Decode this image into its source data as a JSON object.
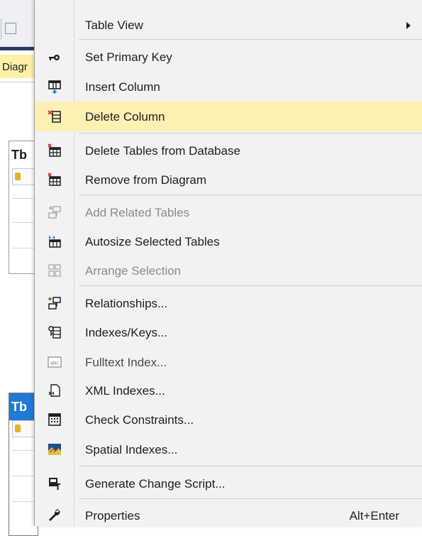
{
  "background": {
    "diagram_tab_label": "Diagr",
    "table1_title": "Tb",
    "table2_title": "Tb"
  },
  "menu": {
    "items": [
      {
        "label": "Table View",
        "icon": "table-view-icon",
        "disabled": false,
        "highlight": false,
        "submenu": true,
        "shortcut": ""
      },
      {
        "label": "Set Primary Key",
        "icon": "key-icon",
        "disabled": false,
        "highlight": false,
        "submenu": false,
        "shortcut": ""
      },
      {
        "label": "Insert Column",
        "icon": "insert-column-icon",
        "disabled": false,
        "highlight": false,
        "submenu": false,
        "shortcut": ""
      },
      {
        "label": "Delete Column",
        "icon": "delete-column-icon",
        "disabled": false,
        "highlight": true,
        "submenu": false,
        "shortcut": ""
      },
      {
        "label": "Delete Tables from Database",
        "icon": "delete-table-icon",
        "disabled": false,
        "highlight": false,
        "submenu": false,
        "shortcut": ""
      },
      {
        "label": "Remove from Diagram",
        "icon": "remove-table-icon",
        "disabled": false,
        "highlight": false,
        "submenu": false,
        "shortcut": ""
      },
      {
        "label": "Add Related Tables",
        "icon": "add-related-tables-icon",
        "disabled": true,
        "highlight": false,
        "submenu": false,
        "shortcut": ""
      },
      {
        "label": "Autosize Selected Tables",
        "icon": "autosize-icon",
        "disabled": false,
        "highlight": false,
        "submenu": false,
        "shortcut": ""
      },
      {
        "label": "Arrange Selection",
        "icon": "arrange-icon",
        "disabled": true,
        "highlight": false,
        "submenu": false,
        "shortcut": ""
      },
      {
        "label": "Relationships...",
        "icon": "relationships-icon",
        "disabled": false,
        "highlight": false,
        "submenu": false,
        "shortcut": ""
      },
      {
        "label": "Indexes/Keys...",
        "icon": "indexes-keys-icon",
        "disabled": false,
        "highlight": false,
        "submenu": false,
        "shortcut": ""
      },
      {
        "label": "Fulltext Index...",
        "icon": "fulltext-index-icon",
        "disabled": false,
        "highlight": false,
        "submenu": false,
        "shortcut": ""
      },
      {
        "label": "XML Indexes...",
        "icon": "xml-indexes-icon",
        "disabled": false,
        "highlight": false,
        "submenu": false,
        "shortcut": ""
      },
      {
        "label": "Check Constraints...",
        "icon": "check-constraints-icon",
        "disabled": false,
        "highlight": false,
        "submenu": false,
        "shortcut": ""
      },
      {
        "label": "Spatial Indexes...",
        "icon": "spatial-indexes-icon",
        "disabled": false,
        "highlight": false,
        "submenu": false,
        "shortcut": ""
      },
      {
        "label": "Generate Change Script...",
        "icon": "generate-script-icon",
        "disabled": false,
        "highlight": false,
        "submenu": false,
        "shortcut": ""
      },
      {
        "label": "Properties",
        "icon": "wrench-icon",
        "disabled": false,
        "highlight": false,
        "submenu": false,
        "shortcut": "Alt+Enter"
      }
    ]
  },
  "colors": {
    "menu_bg": "#f2f2f2",
    "highlight": "#fcf0b2",
    "text": "#1e1e1e",
    "disabled_text": "#8a8a8a",
    "accent_blue": "#1f7ad6"
  }
}
